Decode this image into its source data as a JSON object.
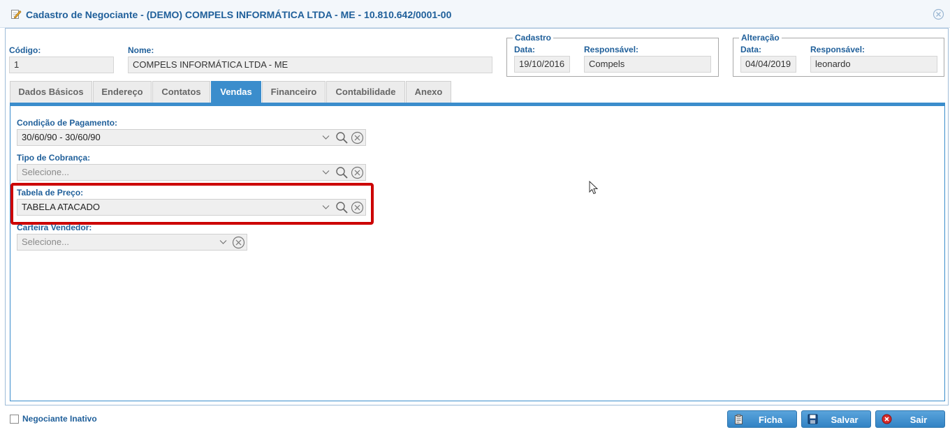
{
  "window": {
    "title": "Cadastro de Negociante - (DEMO) COMPELS INFORMÁTICA LTDA - ME - 10.810.642/0001-00",
    "title_icon": "edit-pencil-icon",
    "close_icon": "close-circle-icon"
  },
  "header": {
    "codigo_label": "Código:",
    "codigo_value": "1",
    "nome_label": "Nome:",
    "nome_value": "COMPELS INFORMÁTICA LTDA - ME",
    "cadastro": {
      "legend": "Cadastro",
      "data_label": "Data:",
      "data_value": "19/10/2016",
      "resp_label": "Responsável:",
      "resp_value": "Compels"
    },
    "alteracao": {
      "legend": "Alteração",
      "data_label": "Data:",
      "data_value": "04/04/2019",
      "resp_label": "Responsável:",
      "resp_value": "leonardo"
    }
  },
  "tabs": [
    {
      "label": "Dados Básicos",
      "active": false
    },
    {
      "label": "Endereço",
      "active": false
    },
    {
      "label": "Contatos",
      "active": false
    },
    {
      "label": "Vendas",
      "active": true
    },
    {
      "label": "Financeiro",
      "active": false
    },
    {
      "label": "Contabilidade",
      "active": false
    },
    {
      "label": "Anexo",
      "active": false
    }
  ],
  "vendas": {
    "condicao_label": "Condição de Pagamento:",
    "condicao_value": "30/60/90 - 30/60/90",
    "tipo_label": "Tipo de Cobrança:",
    "tipo_placeholder": "Selecione...",
    "tabela_label": "Tabela de Preço:",
    "tabela_value": "TABELA ATACADO",
    "carteira_label": "Carteira Vendedor:",
    "carteira_placeholder": "Selecione..."
  },
  "footer": {
    "inativo_label": "Negociante Inativo",
    "inativo_checked": false,
    "ficha_label": "Ficha",
    "salvar_label": "Salvar",
    "sair_label": "Sair"
  },
  "colors": {
    "accent": "#3b8dcc",
    "label": "#1f5f9a",
    "highlight": "#cc0000"
  }
}
